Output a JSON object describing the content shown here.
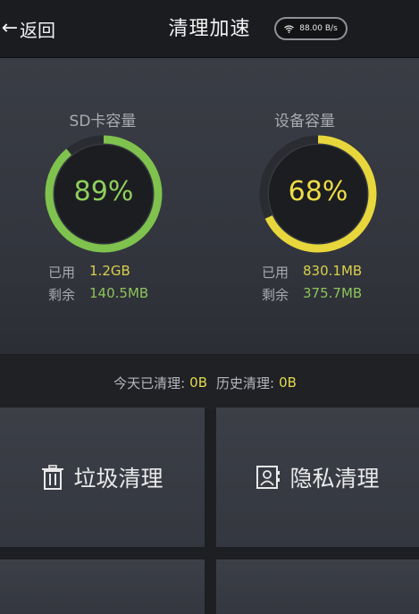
{
  "header": {
    "back_arrow": "←",
    "back_label": "返回",
    "title": "清理加速",
    "network_speed": "88.00 B/s",
    "wifi_icon": "wifi-icon"
  },
  "storage": {
    "sd": {
      "label": "SD卡容量",
      "percent_text": "89%",
      "percent": 89,
      "used_label": "已用",
      "used_value": "1.2GB",
      "remain_label": "剩余",
      "remain_value": "140.5MB",
      "ring_color": "#7fc24e",
      "text_color": "#8fcf5c"
    },
    "device": {
      "label": "设备容量",
      "percent_text": "68%",
      "percent": 68,
      "used_label": "已用",
      "used_value": "830.1MB",
      "remain_label": "剩余",
      "remain_value": "375.7MB",
      "ring_color": "#e8d73c",
      "text_color": "#eedc45"
    }
  },
  "summary": {
    "today_label": "今天已清理:",
    "today_value": "0B",
    "history_label": "历史清理:",
    "history_value": "0B"
  },
  "actions": {
    "junk_label": "垃圾清理",
    "junk_icon": "trash-icon",
    "privacy_label": "隐私清理",
    "privacy_icon": "contact-card-icon"
  },
  "colors": {
    "accent_yellow": "#e3da4e",
    "accent_green": "#8dc35a",
    "panel_bg": "#373a42"
  }
}
